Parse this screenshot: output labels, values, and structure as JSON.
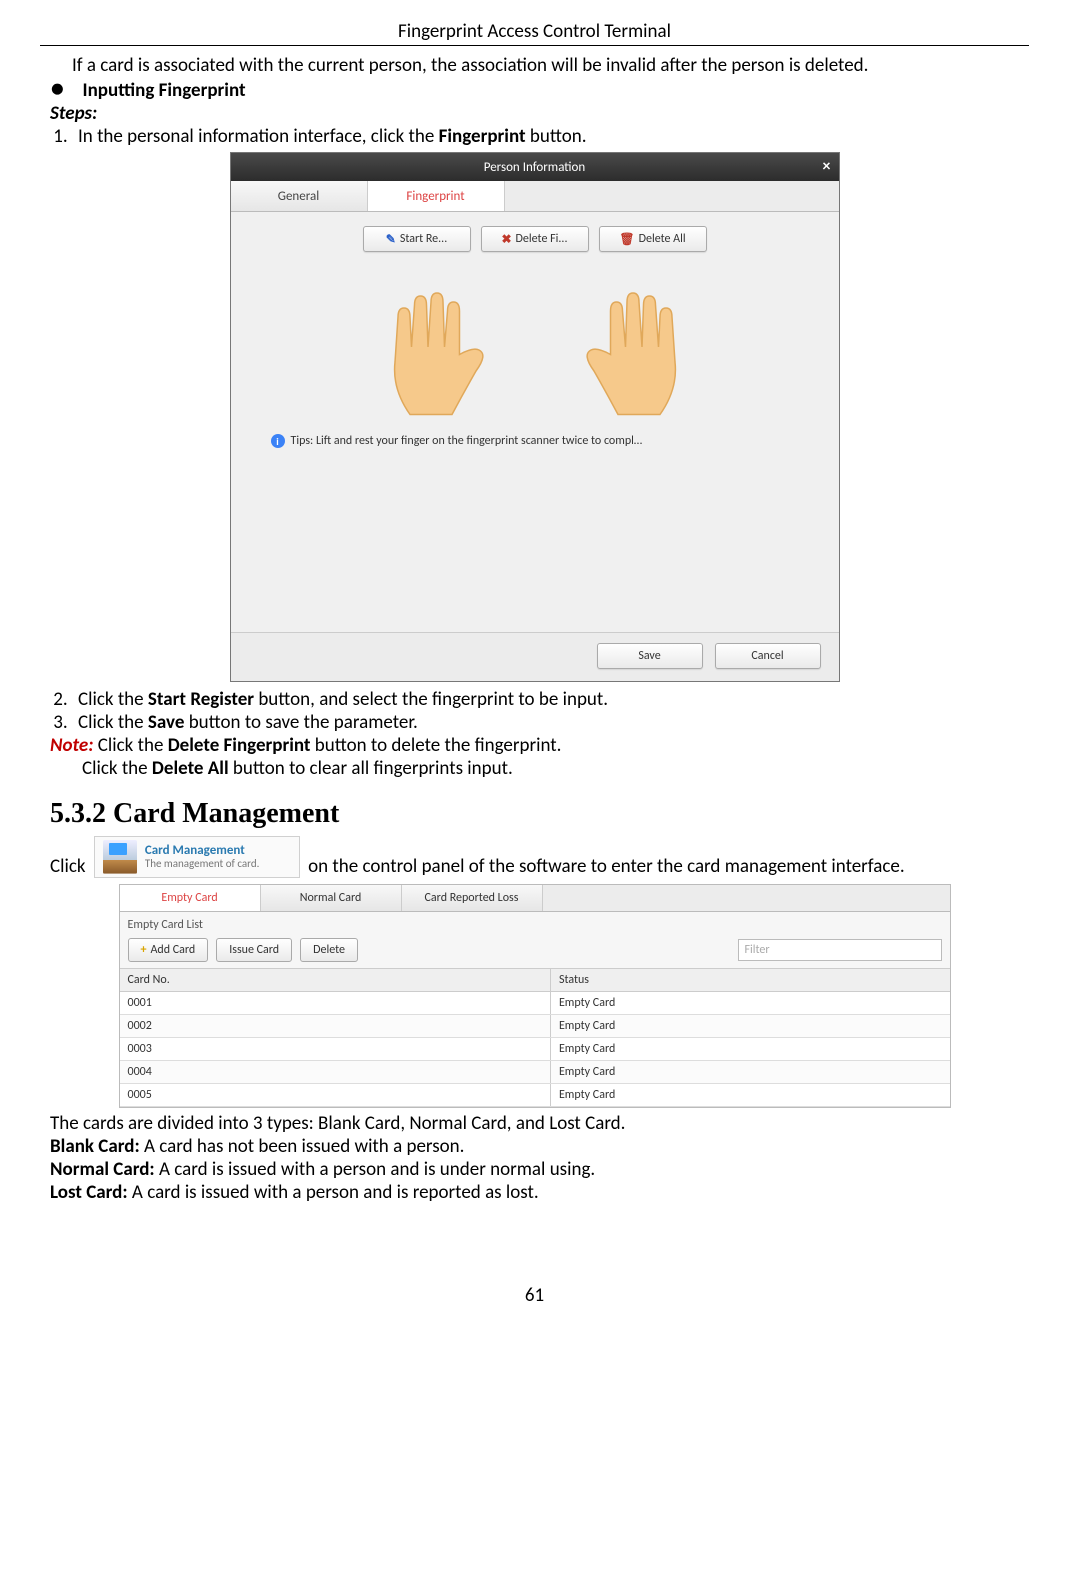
{
  "header": {
    "title": "Fingerprint Access Control Terminal"
  },
  "footer": {
    "page_number": "61"
  },
  "intro_para": "If a card is associated with the current person, the association will be invalid after the person is deleted.",
  "bullet_heading": "Inputting Fingerprint",
  "steps_label": "Steps:",
  "step1_pre": "In the personal information interface, click the ",
  "step1_bold": "Fingerprint",
  "step1_post": " button.",
  "step2_pre": "Click the ",
  "step2_bold": "Start Register",
  "step2_post": " button, and select the fingerprint to be input.",
  "step3_pre": "Click the ",
  "step3_bold": "Save",
  "step3_post": " button to save the parameter.",
  "note_label": "Note:",
  "note_line1_pre": " Click the ",
  "note_line1_bold": "Delete Fingerprint",
  "note_line1_post": " button to delete the fingerprint.",
  "note_line2_pre": "Click the ",
  "note_line2_bold": "Delete All",
  "note_line2_post": " button to clear all fingerprints input.",
  "section_heading": "5.3.2   Card Management",
  "click_word": "Click ",
  "cm_icon_title": "Card Management",
  "cm_icon_sub": "The management of card.",
  "click_rest": " on the control panel of the software to enter the card management interface.",
  "types_line": "The cards are divided into 3 types: Blank Card, Normal Card, and Lost Card.",
  "blank_label": "Blank Card:",
  "blank_desc": " A card has not been issued with a person.",
  "normal_label": "Normal Card:",
  "normal_desc": " A card is issued with a person and is under normal using.",
  "lost_label": "Lost Card:",
  "lost_desc": " A card is issued with a person and is reported as lost.",
  "pi_dialog": {
    "title": "Person Information",
    "tab_general": "General",
    "tab_fingerprint": "Fingerprint",
    "btn_start": "Start Re...",
    "btn_delete_fp": "Delete Fi...",
    "btn_delete_all": "Delete All",
    "tips": "Tips: Lift and rest your finger on the fingerprint scanner twice to compl…",
    "btn_save": "Save",
    "btn_cancel": "Cancel"
  },
  "cm_panel": {
    "tab_empty": "Empty Card",
    "tab_normal": "Normal Card",
    "tab_lost": "Card Reported Loss",
    "section_label": "Empty Card List",
    "btn_add": "Add Card",
    "btn_issue": "Issue Card",
    "btn_delete": "Delete",
    "filter_placeholder": "Filter",
    "col_no": "Card No.",
    "col_status": "Status",
    "rows": [
      {
        "no": "0001",
        "status": "Empty Card"
      },
      {
        "no": "0002",
        "status": "Empty Card"
      },
      {
        "no": "0003",
        "status": "Empty Card"
      },
      {
        "no": "0004",
        "status": "Empty Card"
      },
      {
        "no": "0005",
        "status": "Empty Card"
      }
    ]
  }
}
